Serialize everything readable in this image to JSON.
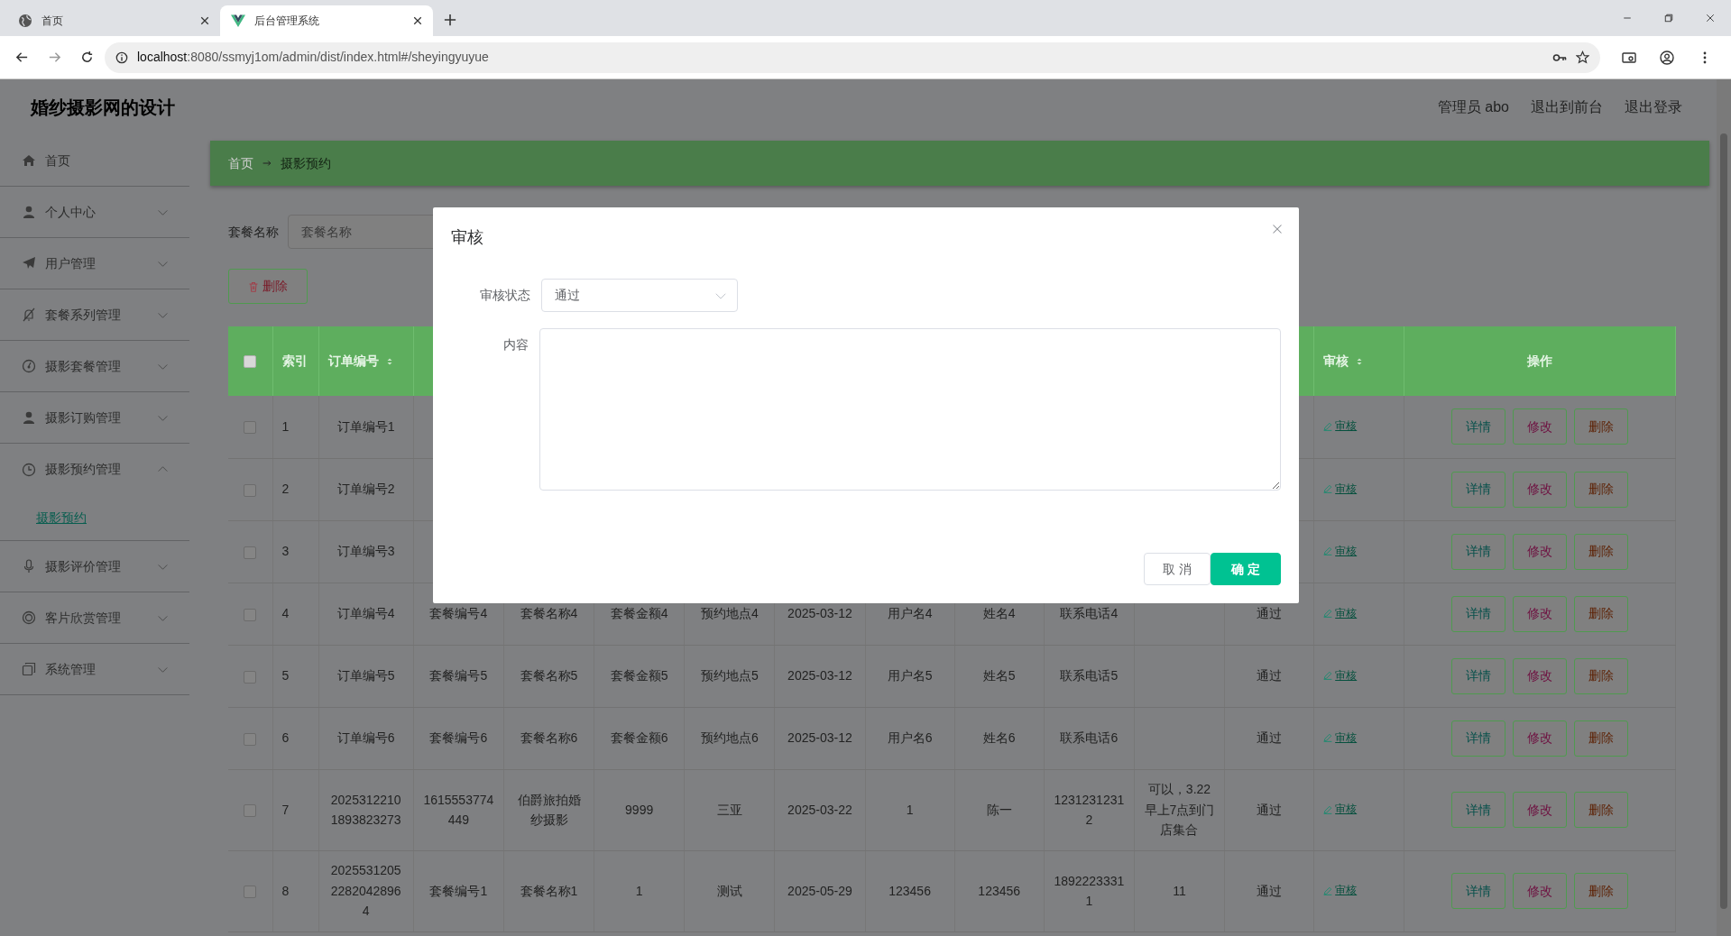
{
  "browser": {
    "tabs": [
      {
        "title": "首页",
        "kind": "globe",
        "selected": false
      },
      {
        "title": "后台管理系统",
        "kind": "vue",
        "selected": true
      }
    ],
    "url_host": "localhost",
    "url_rest": ":8080/ssmyj1om/admin/dist/index.html#/sheyingyuyue"
  },
  "app": {
    "title": "婚纱摄影网的设计",
    "header_links": [
      "管理员 abo",
      "退出到前台",
      "退出登录"
    ]
  },
  "sidebar": {
    "items": [
      {
        "label": "首页",
        "kind": "link"
      },
      {
        "label": "个人中心",
        "kind": "menu",
        "expanded": false
      },
      {
        "label": "用户管理",
        "kind": "menu",
        "expanded": false
      },
      {
        "label": "套餐系列管理",
        "kind": "menu",
        "expanded": false
      },
      {
        "label": "摄影套餐管理",
        "kind": "menu",
        "expanded": false
      },
      {
        "label": "摄影订购管理",
        "kind": "menu",
        "expanded": false
      },
      {
        "label": "摄影预约管理",
        "kind": "menu",
        "expanded": true,
        "children": [
          {
            "label": "摄影预约",
            "selected": true
          }
        ]
      },
      {
        "label": "摄影评价管理",
        "kind": "menu",
        "expanded": false
      },
      {
        "label": "客片欣赏管理",
        "kind": "menu",
        "expanded": false
      },
      {
        "label": "系统管理",
        "kind": "menu",
        "expanded": false
      }
    ]
  },
  "breadcrumb": [
    "首页",
    "摄影预约"
  ],
  "search": {
    "label": "套餐名称",
    "placeholder": "套餐名称"
  },
  "delete_button": "删除",
  "table": {
    "all_checked": false,
    "columns": [
      {
        "label": "索引"
      },
      {
        "label": "订单编号",
        "sortable": true
      },
      null,
      null,
      null,
      null,
      null,
      null,
      null,
      null,
      null,
      null,
      {
        "label": "审核",
        "sortable": true
      },
      {
        "label": "操作"
      }
    ],
    "rows": [
      {
        "checked": false,
        "cells": [
          "1",
          "订单编号1",
          null,
          null,
          null,
          null,
          null,
          null,
          null,
          null,
          null,
          null
        ],
        "audit": "审核",
        "actions": [
          "详情",
          "修改",
          "删除"
        ]
      },
      {
        "checked": false,
        "cells": [
          "2",
          "订单编号2",
          null,
          null,
          null,
          null,
          null,
          null,
          null,
          null,
          null,
          null
        ],
        "audit": "审核",
        "actions": [
          "详情",
          "修改",
          "删除"
        ]
      },
      {
        "checked": false,
        "cells": [
          "3",
          "订单编号3",
          null,
          null,
          null,
          null,
          null,
          null,
          null,
          null,
          null,
          null
        ],
        "audit": "审核",
        "actions": [
          "详情",
          "修改",
          "删除"
        ]
      },
      {
        "checked": false,
        "cells": [
          "4",
          "订单编号4",
          "套餐编号4",
          "套餐名称4",
          "套餐金额4",
          "预约地点4",
          "2025-03-12",
          "用户名4",
          "姓名4",
          "联系电话4",
          null,
          "通过"
        ],
        "audit": "审核",
        "actions": [
          "详情",
          "修改",
          "删除"
        ]
      },
      {
        "checked": false,
        "cells": [
          "5",
          "订单编号5",
          "套餐编号5",
          "套餐名称5",
          "套餐金额5",
          "预约地点5",
          "2025-03-12",
          "用户名5",
          "姓名5",
          "联系电话5",
          null,
          "通过"
        ],
        "audit": "审核",
        "actions": [
          "详情",
          "修改",
          "删除"
        ]
      },
      {
        "checked": false,
        "cells": [
          "6",
          "订单编号6",
          "套餐编号6",
          "套餐名称6",
          "套餐金额6",
          "预约地点6",
          "2025-03-12",
          "用户名6",
          "姓名6",
          "联系电话6",
          null,
          "通过"
        ],
        "audit": "审核",
        "actions": [
          "详情",
          "修改",
          "删除"
        ]
      },
      {
        "checked": false,
        "cells": [
          "7",
          "20253122101893823273",
          "1615553774449",
          "伯爵旅拍婚纱摄影",
          "9999",
          "三亚",
          "2025-03-22",
          "1",
          "陈一",
          "12312312312",
          "可以，3.22早上7点到门店集合",
          "通过"
        ],
        "audit": "审核",
        "actions": [
          "详情",
          "修改",
          "删除"
        ]
      },
      {
        "checked": false,
        "cells": [
          "8",
          "202553120522820428964",
          "套餐编号1",
          "套餐名称1",
          "1",
          "测试",
          "2025-05-29",
          "123456",
          "123456",
          "18922233311",
          "11",
          "通过"
        ],
        "audit": "审核",
        "actions": [
          "详情",
          "修改",
          "删除"
        ]
      }
    ]
  },
  "dialog": {
    "title": "审核",
    "status_label": "审核状态",
    "status_value": "通过",
    "content_label": "内容",
    "buttons": [
      {
        "label": "取 消",
        "kind": "plain"
      },
      {
        "label": "确 定",
        "kind": "primary"
      }
    ]
  }
}
